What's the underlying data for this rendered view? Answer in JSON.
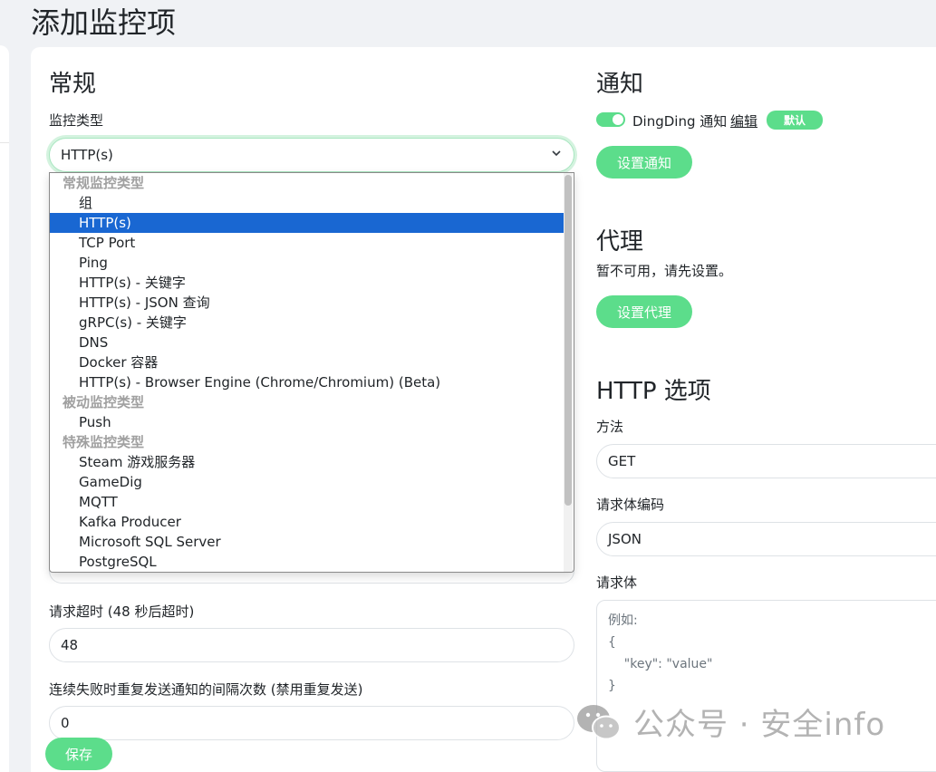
{
  "page": {
    "title": "添加监控项"
  },
  "general": {
    "heading": "常规",
    "monitor_type_label": "监控类型",
    "monitor_type_value": "HTTP(s)",
    "dropdown": [
      {
        "group": "常规监控类型",
        "items": [
          "组",
          "HTTP(s)",
          "TCP Port",
          "Ping",
          "HTTP(s) - 关键字",
          "HTTP(s) - JSON 查询",
          "gRPC(s) - 关键字",
          "DNS",
          "Docker 容器",
          "HTTP(s) - Browser Engine (Chrome/Chromium) (Beta)"
        ]
      },
      {
        "group": "被动监控类型",
        "items": [
          "Push"
        ]
      },
      {
        "group": "特殊监控类型",
        "items": [
          "Steam 游戏服务器",
          "GameDig",
          "MQTT",
          "Kafka Producer",
          "Microsoft SQL Server",
          "PostgreSQL"
        ]
      }
    ],
    "selected_item": "HTTP(s)",
    "timeout_label": "请求超时 (48 秒后超时)",
    "timeout_value": "48",
    "resend_label": "连续失败时重复发送通知的间隔次数 (禁用重复发送)",
    "resend_value": "0",
    "save_button": "保存"
  },
  "notification": {
    "heading": "通知",
    "item_name": "DingDing 通知",
    "edit_link": "编辑",
    "default_badge": "默认",
    "setup_button": "设置通知",
    "toggle_on": true
  },
  "proxy": {
    "heading": "代理",
    "unavailable_text": "暂不可用，请先设置。",
    "setup_button": "设置代理"
  },
  "http_options": {
    "heading": "HTTP 选项",
    "method_label": "方法",
    "method_value": "GET",
    "body_encoding_label": "请求体编码",
    "body_encoding_value": "JSON",
    "body_label": "请求体",
    "body_placeholder": "例如:\n{\n    \"key\": \"value\"\n}"
  },
  "watermark": {
    "text": "公众号 · 安全info"
  },
  "colors": {
    "accent": "#5cdd8b",
    "selected": "#1967d2"
  }
}
